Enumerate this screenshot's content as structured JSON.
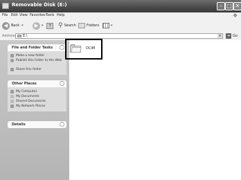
{
  "window": {
    "title": "Removable Disk (E:)"
  },
  "menu": [
    "File",
    "Edit",
    "View",
    "Favorites",
    "Tools",
    "Help"
  ],
  "toolbar": {
    "back": "Back",
    "search": "Search",
    "folders": "Folders"
  },
  "address": {
    "label": "Address",
    "value": "E:\\",
    "go": "Go"
  },
  "panels": [
    {
      "title": "File and Folder Tasks",
      "items": [
        "Make a new folder",
        "Publish this folder to the Web",
        "Share this folder"
      ]
    },
    {
      "title": "Other Places",
      "items": [
        "My Computer",
        "My Documents",
        "Shared Documents",
        "My Network Places"
      ]
    },
    {
      "title": "Details",
      "items": []
    }
  ],
  "content": {
    "items": [
      {
        "name": "DCIM",
        "type": "folder",
        "selected": true
      }
    ]
  }
}
